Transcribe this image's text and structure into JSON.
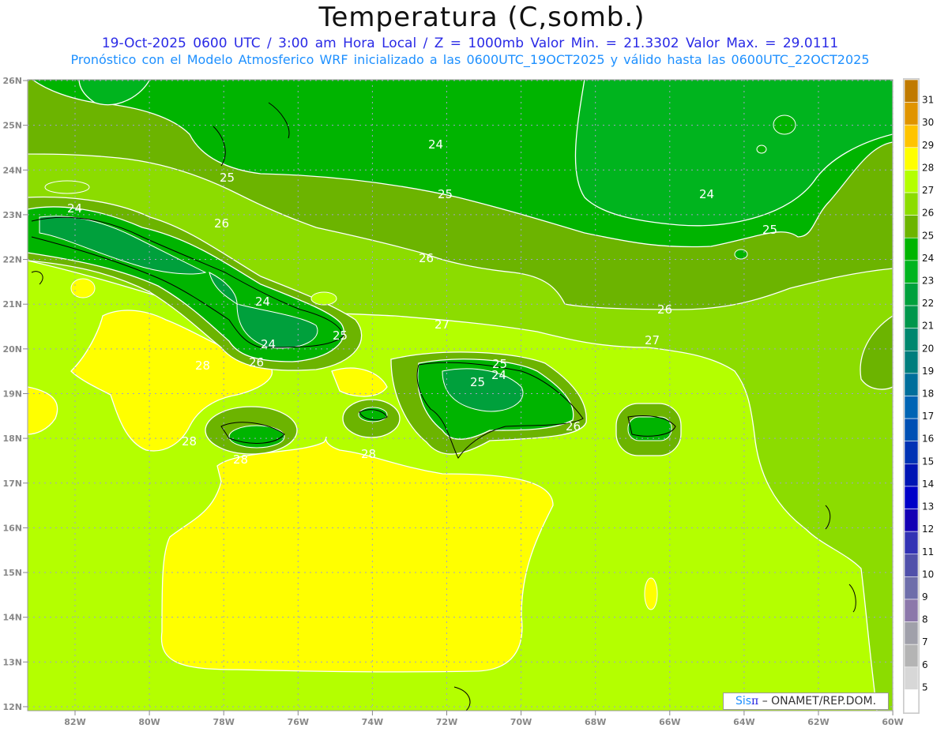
{
  "header": {
    "title": "Temperatura (C,somb.)",
    "line1": "19-Oct-2025  0600 UTC / 3:00 am Hora Local / Z = 1000mb   Valor Min. = 21.3302  Valor Max. = 29.0111",
    "line2": "Pronóstico con el Modelo Atmosferico WRF inicializado a las 0600UTC_19OCT2025 y válido hasta las  0600UTC_22OCT2025"
  },
  "axes": {
    "lon_labels": [
      "82W",
      "80W",
      "78W",
      "76W",
      "74W",
      "72W",
      "70W",
      "68W",
      "66W",
      "64W",
      "62W",
      "60W"
    ],
    "lat_labels": [
      "26N",
      "25N",
      "24N",
      "23N",
      "22N",
      "21N",
      "20N",
      "19N",
      "18N",
      "17N",
      "16N",
      "15N",
      "14N",
      "13N",
      "12N"
    ]
  },
  "colorbar": {
    "labels": [
      "31",
      "30",
      "29",
      "28",
      "27",
      "26",
      "25",
      "24",
      "23",
      "22",
      "21",
      "20",
      "19",
      "18",
      "17",
      "16",
      "15",
      "14",
      "13",
      "12",
      "11",
      "10",
      "9",
      "8",
      "7",
      "6",
      "5"
    ],
    "colors": [
      "#c07a00",
      "#e09400",
      "#ffc400",
      "#ffff00",
      "#b4ff00",
      "#8cdc00",
      "#6cb400",
      "#00b400",
      "#00b41e",
      "#00a03c",
      "#00964b",
      "#00876e",
      "#007d7d",
      "#006e9b",
      "#0064b4",
      "#0050b4",
      "#0032b4",
      "#0014b4",
      "#0000c8",
      "#1400b4",
      "#3232b4",
      "#5050aa",
      "#6e6eaa",
      "#8c78aa",
      "#a0a0aa",
      "#b4b4b4",
      "#d7d7d7",
      "#ffffff"
    ]
  },
  "contour_labels": [
    "24",
    "25",
    "24",
    "25",
    "26",
    "26",
    "24",
    "25",
    "27",
    "26",
    "27",
    "24",
    "25",
    "26",
    "28",
    "28",
    "28",
    "28",
    "24",
    "25",
    "26",
    "25",
    "24"
  ],
  "credit": {
    "sis": "Sis",
    "pi": "π",
    "org": " – ONAMET/REP.DOM."
  }
}
